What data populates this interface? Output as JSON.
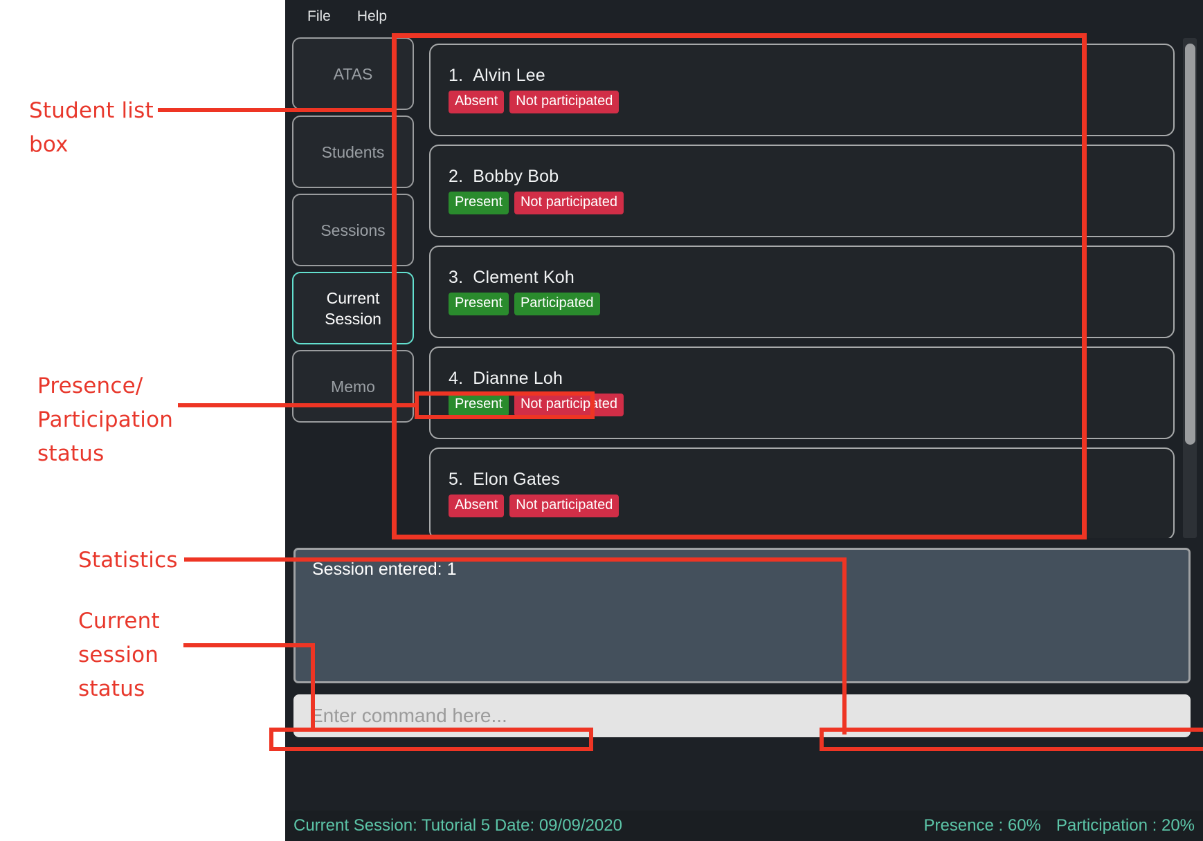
{
  "menu": {
    "items": [
      {
        "label": "File",
        "name": "menu-file"
      },
      {
        "label": "Help",
        "name": "menu-help"
      }
    ]
  },
  "sidebar": {
    "items": [
      {
        "label": "ATAS",
        "active": false
      },
      {
        "label": "Students",
        "active": false
      },
      {
        "label": "Sessions",
        "active": false
      },
      {
        "label": "Current\nSession",
        "active": true
      },
      {
        "label": "Memo",
        "active": false
      }
    ]
  },
  "student_list": {
    "items": [
      {
        "index": "1.",
        "name": "Alvin Lee",
        "presence": {
          "label": "Absent",
          "color": "#d12e47",
          "state": "red"
        },
        "participation": {
          "label": "Not participated",
          "color": "#d12e47",
          "state": "red"
        }
      },
      {
        "index": "2.",
        "name": "Bobby Bob",
        "presence": {
          "label": "Present",
          "color": "#2a8b2d",
          "state": "green"
        },
        "participation": {
          "label": "Not participated",
          "color": "#d12e47",
          "state": "red"
        }
      },
      {
        "index": "3.",
        "name": "Clement Koh",
        "presence": {
          "label": "Present",
          "color": "#2a8b2d",
          "state": "green"
        },
        "participation": {
          "label": "Participated",
          "color": "#2a8b2d",
          "state": "green"
        }
      },
      {
        "index": "4.",
        "name": "Dianne Loh",
        "presence": {
          "label": "Present",
          "color": "#2a8b2d",
          "state": "green"
        },
        "participation": {
          "label": "Not participated",
          "color": "#d12e47",
          "state": "red"
        }
      },
      {
        "index": "5.",
        "name": "Elon Gates",
        "presence": {
          "label": "Absent",
          "color": "#d12e47",
          "state": "red"
        },
        "participation": {
          "label": "Not participated",
          "color": "#d12e47",
          "state": "red"
        }
      }
    ]
  },
  "results_panel": {
    "text": "Session entered: 1"
  },
  "command_box": {
    "value": "",
    "placeholder": "Enter command here..."
  },
  "status_bar": {
    "current_session": "Current Session: Tutorial 5   Date: 09/09/2020",
    "presence": "Presence : 60%",
    "participation": "Participation : 20%",
    "accent_color": "#5cc5a8"
  },
  "annotations": {
    "accent_color": "#ee3524",
    "labels": [
      {
        "text": "Student list\nbox",
        "target": "student-list-box"
      },
      {
        "text": "Presence/\nParticipation\nstatus",
        "target": "presence-participation-status"
      },
      {
        "text": "Statistics",
        "target": "statistics"
      },
      {
        "text": "Current\nsession\nstatus",
        "target": "current-session-status"
      }
    ]
  }
}
